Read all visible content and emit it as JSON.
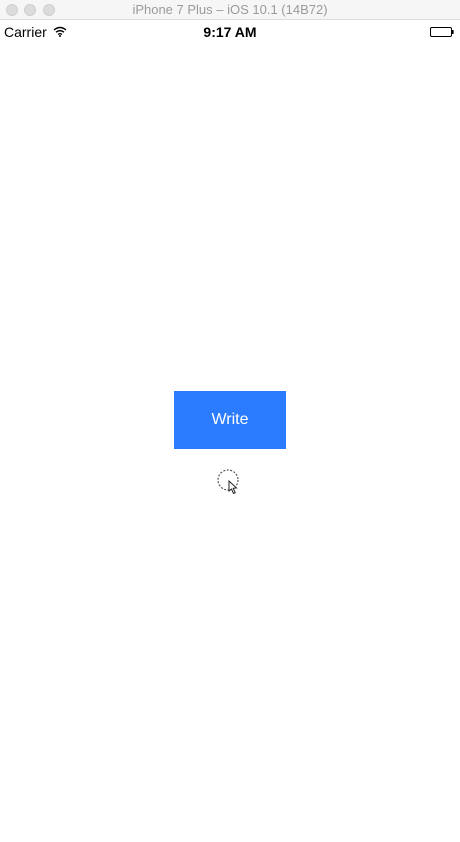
{
  "window": {
    "title": "iPhone 7 Plus – iOS 10.1 (14B72)"
  },
  "status_bar": {
    "carrier": "Carrier",
    "time": "9:17 AM",
    "icons": [
      "wifi-icon",
      "battery-icon"
    ]
  },
  "main": {
    "write_button_label": "Write"
  },
  "colors": {
    "accent": "#2b7bff",
    "titlebar": "#f6f6f6",
    "background": "#ffffff"
  }
}
